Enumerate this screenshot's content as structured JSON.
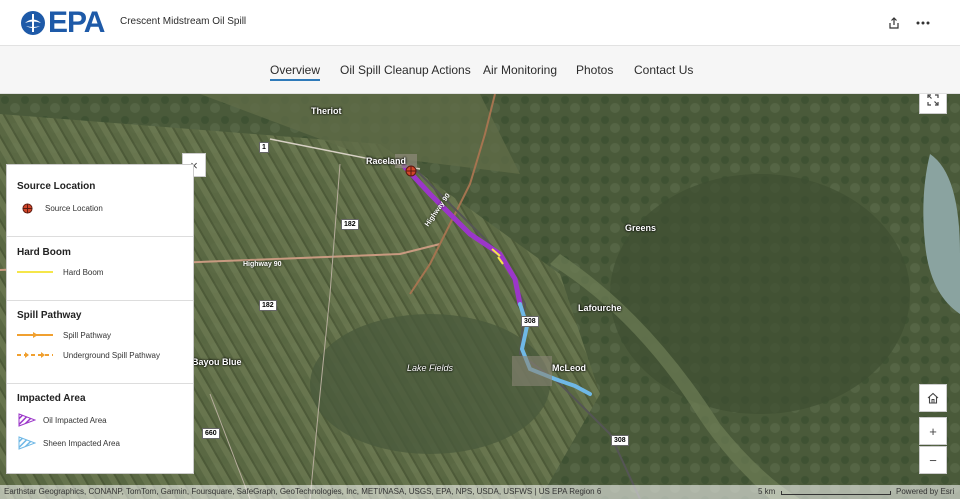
{
  "header": {
    "logo_text": "EPA",
    "app_title": "Crescent Midstream Oil Spill",
    "share_icon": "share-icon",
    "more_icon": "more-icon"
  },
  "nav": {
    "items": [
      {
        "label": "Overview",
        "active": true
      },
      {
        "label": "Oil Spill Cleanup Actions",
        "active": false
      },
      {
        "label": "Air Monitoring",
        "active": false
      },
      {
        "label": "Photos",
        "active": false
      },
      {
        "label": "Contact Us",
        "active": false
      }
    ]
  },
  "map": {
    "places": {
      "theriot": "Theriot",
      "raceland": "Raceland",
      "greens": "Greens",
      "lafourche": "Lafourche",
      "mcleod": "McLeod",
      "lake_fields": "Lake Fields",
      "bayou_blue": "Bayou Blue"
    },
    "roads": {
      "hwy1": "1",
      "hwy182a": "182",
      "hwy182b": "182",
      "hwy308a": "308",
      "hwy308b": "308",
      "hwy660": "660",
      "hwy90": "Highway 90",
      "hwy90_diag": "Highway 90"
    },
    "controls": {
      "expand": "expand-icon",
      "home": "home-icon",
      "zoom_in": "+",
      "zoom_out": "−"
    }
  },
  "legend": {
    "close": "×",
    "sections": [
      {
        "title": "Source Location",
        "items": [
          {
            "label": "Source Location",
            "symbol": "source-location-icon"
          }
        ]
      },
      {
        "title": "Hard Boom",
        "items": [
          {
            "label": "Hard Boom",
            "symbol": "yellow-line"
          }
        ]
      },
      {
        "title": "Spill Pathway",
        "items": [
          {
            "label": "Spill Pathway",
            "symbol": "orange-arrow-line"
          },
          {
            "label": "Underground Spill Pathway",
            "symbol": "orange-dashed-arrow-line"
          }
        ]
      },
      {
        "title": "Impacted Area",
        "items": [
          {
            "label": "Oil Impacted Area",
            "symbol": "purple-hatched-polygon"
          },
          {
            "label": "Sheen Impacted Area",
            "symbol": "blue-hatched-polygon"
          }
        ]
      }
    ]
  },
  "attribution": {
    "text": "Earthstar Geographics, CONANP, TomTom, Garmin, Foursquare, SafeGraph, GeoTechnologies, Inc, METI/NASA, USGS, EPA, NPS, USDA, USFWS | US EPA Region 6",
    "scale": "5 km",
    "powered": "Powered by Esri"
  },
  "colors": {
    "epa_blue": "#1e5aa8",
    "nav_accent": "#2f7ab9",
    "oil_purple": "#9b36c9",
    "sheen_blue": "#6fb8e6",
    "hard_boom_yellow": "#f5e64a",
    "spill_orange": "#f0a030",
    "source_red": "#d2462a"
  }
}
